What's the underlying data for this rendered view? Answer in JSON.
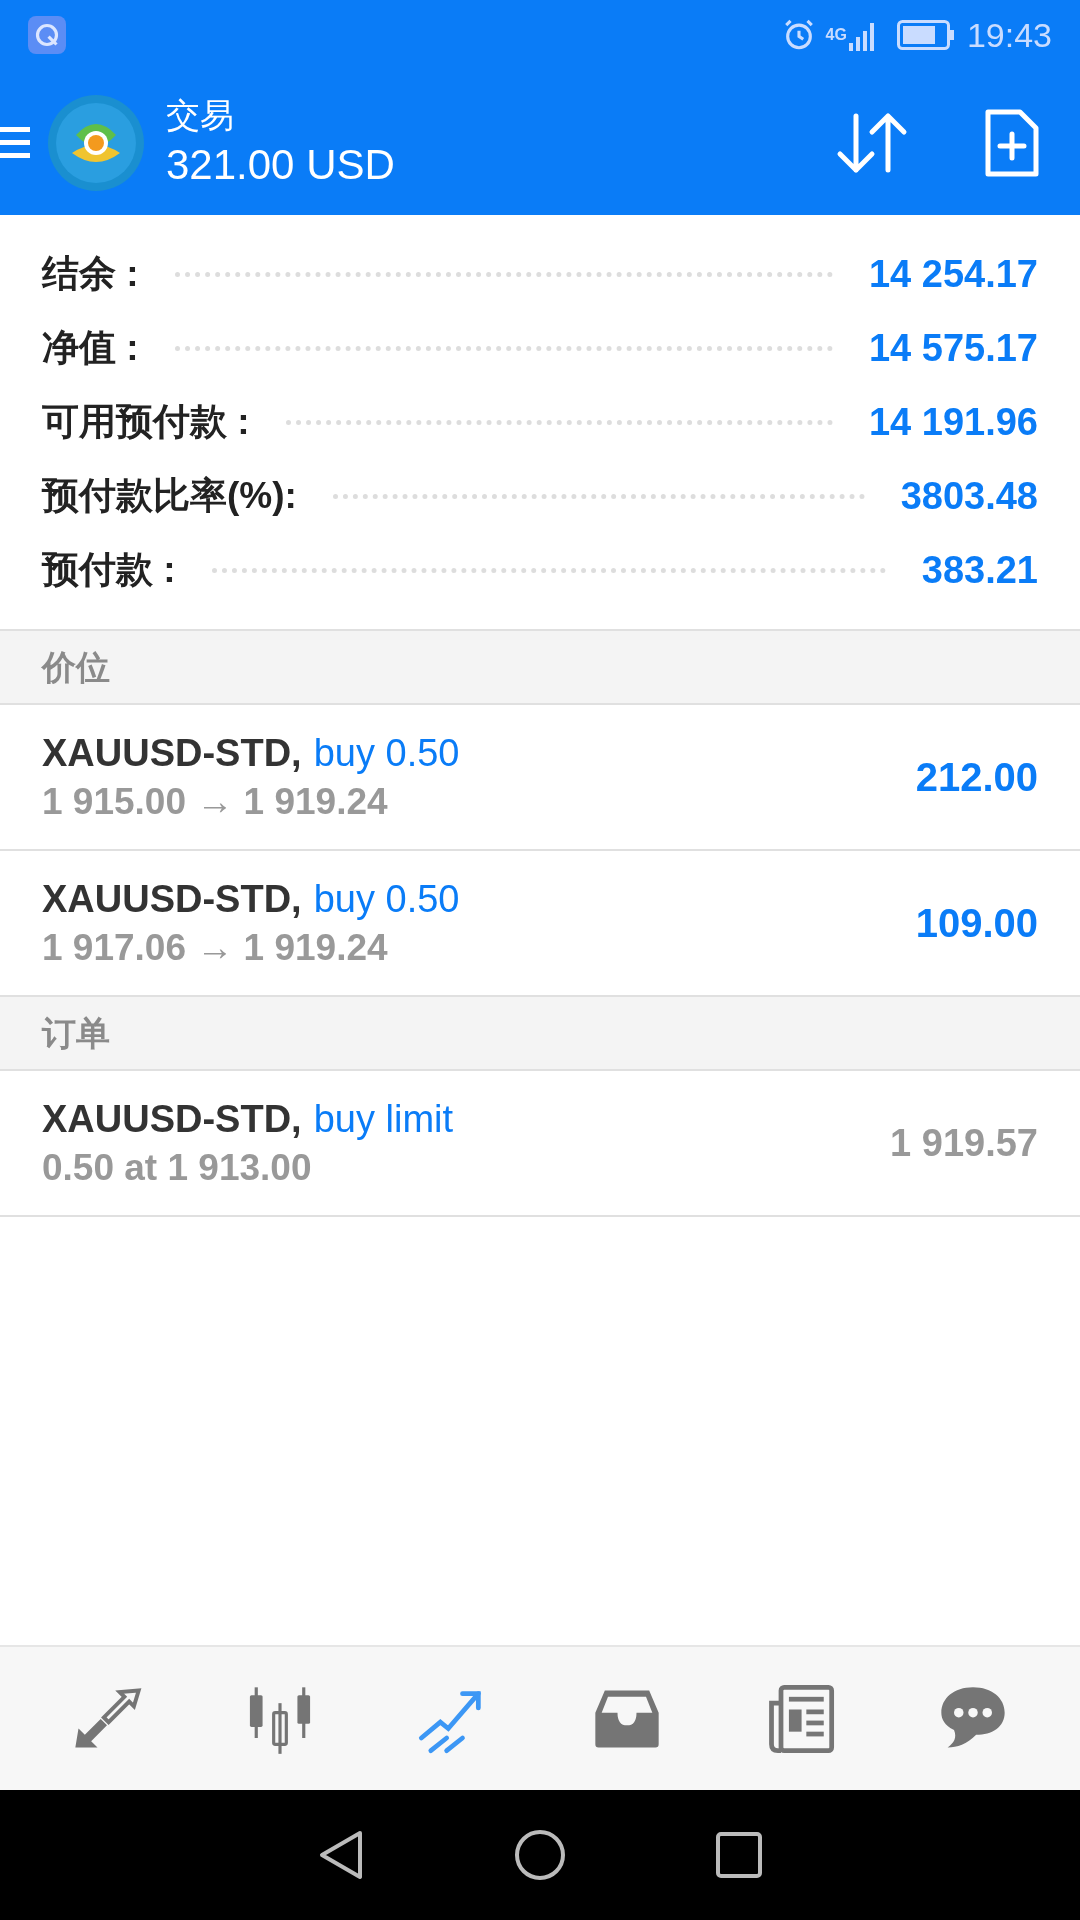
{
  "status_bar": {
    "network": "4G",
    "time": "19:43"
  },
  "header": {
    "title": "交易",
    "balance": "321.00 USD"
  },
  "summary": [
    {
      "label": "结余 :",
      "value": "14 254.17"
    },
    {
      "label": "净值 :",
      "value": "14 575.17"
    },
    {
      "label": "可用预付款 :",
      "value": "14 191.96"
    },
    {
      "label": "预付款比率(%):",
      "value": "3803.48"
    },
    {
      "label": "预付款 :",
      "value": "383.21"
    }
  ],
  "sections": [
    {
      "title": "价位",
      "items": [
        {
          "symbol": "XAUUSD-STD,",
          "type": "buy 0.50",
          "detail": "1 915.00 → 1 919.24",
          "value": "212.00",
          "kind": "position"
        },
        {
          "symbol": "XAUUSD-STD,",
          "type": "buy 0.50",
          "detail": "1 917.06 → 1 919.24",
          "value": "109.00",
          "kind": "position"
        }
      ]
    },
    {
      "title": "订单",
      "items": [
        {
          "symbol": "XAUUSD-STD,",
          "type": "buy limit",
          "detail": "0.50 at 1 913.00",
          "value": "1 919.57",
          "kind": "order"
        }
      ]
    }
  ],
  "bottom_nav": [
    {
      "kind": "quotes",
      "selected": false
    },
    {
      "kind": "chart",
      "selected": false
    },
    {
      "kind": "trade",
      "selected": true
    },
    {
      "kind": "history",
      "selected": false
    },
    {
      "kind": "news",
      "selected": false
    },
    {
      "kind": "chat",
      "selected": false
    }
  ]
}
